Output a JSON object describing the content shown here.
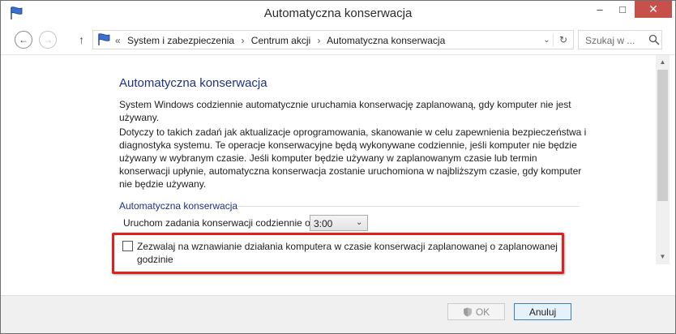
{
  "window": {
    "title": "Automatyczna konserwacja",
    "minimize": "–",
    "maximize": "□",
    "close": "✕"
  },
  "nav": {
    "back": "←",
    "forward": "→",
    "up": "↑",
    "breadcrumb_prefix": "«",
    "breadcrumbs": [
      "System i zabezpieczenia",
      "Centrum akcji",
      "Automatyczna konserwacja"
    ],
    "breadcrumb_separator": "›",
    "dropdown": "⌄",
    "refresh": "↻",
    "search_placeholder": "Szukaj w ..."
  },
  "main": {
    "heading": "Automatyczna konserwacja",
    "paragraph1": "System Windows codziennie automatycznie uruchamia konserwację zaplanowaną, gdy komputer nie jest używany.",
    "paragraph2": "Dotyczy to takich zadań jak aktualizacje oprogramowania, skanowanie w celu zapewnienia bezpieczeństwa i diagnostyka systemu. Te operacje konserwacyjne będą wykonywane codziennie, jeśli komputer nie będzie używany w wybranym czasie. Jeśli komputer będzie używany w zaplanowanym czasie lub termin konserwacji upłynie, automatyczna konserwacja zostanie uruchomiona w najbliższym czasie, gdy komputer nie będzie używany.",
    "group_label": "Automatyczna konserwacja",
    "schedule_label": "Uruchom zadania konserwacji codziennie o",
    "schedule_time": "3:00",
    "wake_checkbox_label": "Zezwalaj na wznawianie działania komputera w czasie konserwacji zaplanowanej o zaplanowanej godzinie",
    "wake_checked": false
  },
  "footer": {
    "ok_label": "OK",
    "cancel_label": "Anuluj"
  },
  "colors": {
    "heading_blue": "#1e3287",
    "highlight_red": "#e0201f",
    "close_red": "#c7504a"
  }
}
